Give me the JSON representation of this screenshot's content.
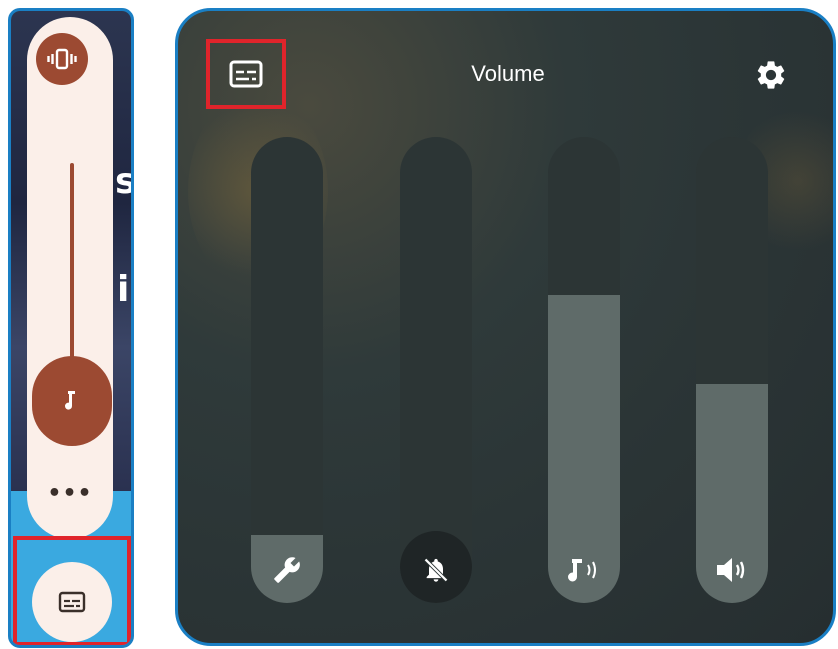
{
  "left_panel": {
    "background_letters": [
      "s",
      "i"
    ],
    "more_label": "•••",
    "vibrate_icon": "vibrate-icon",
    "caption_icon": "caption-icon",
    "ringer_slider_level": 0.0
  },
  "right_panel": {
    "title": "Volume",
    "caption_icon": "caption-icon",
    "settings_icon": "gear-icon",
    "sliders": [
      {
        "name": "system",
        "icon": "wrench-icon",
        "level": 0.12
      },
      {
        "name": "notifications",
        "icon": "bell-muted-icon",
        "level": 0.0
      },
      {
        "name": "media",
        "icon": "music-note-icon",
        "level": 0.66
      },
      {
        "name": "call",
        "icon": "speaker-icon",
        "level": 0.47
      }
    ]
  },
  "colors": {
    "accent": "#9c4a32",
    "pill": "#fbefe9",
    "highlight_border": "#e0242b",
    "frame_border": "#1a7fc4"
  }
}
